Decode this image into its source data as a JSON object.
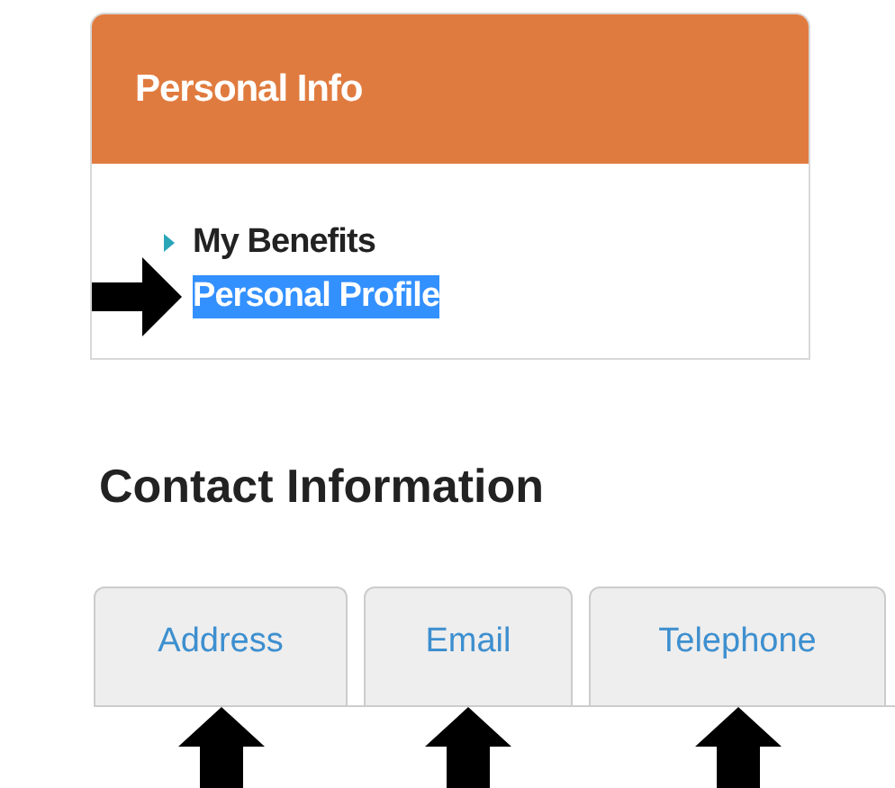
{
  "panel": {
    "title": "Personal Info",
    "items": [
      {
        "label": "My Benefits",
        "selected": false,
        "arrow": false
      },
      {
        "label": "Personal Profile",
        "selected": true,
        "arrow": true
      }
    ]
  },
  "contact": {
    "title": "Contact Information",
    "tabs": [
      {
        "label": "Address",
        "selected": false,
        "arrow": true
      },
      {
        "label": "Email",
        "selected": false,
        "arrow": true
      },
      {
        "label": "Telephone",
        "selected": false,
        "arrow": true
      }
    ]
  }
}
